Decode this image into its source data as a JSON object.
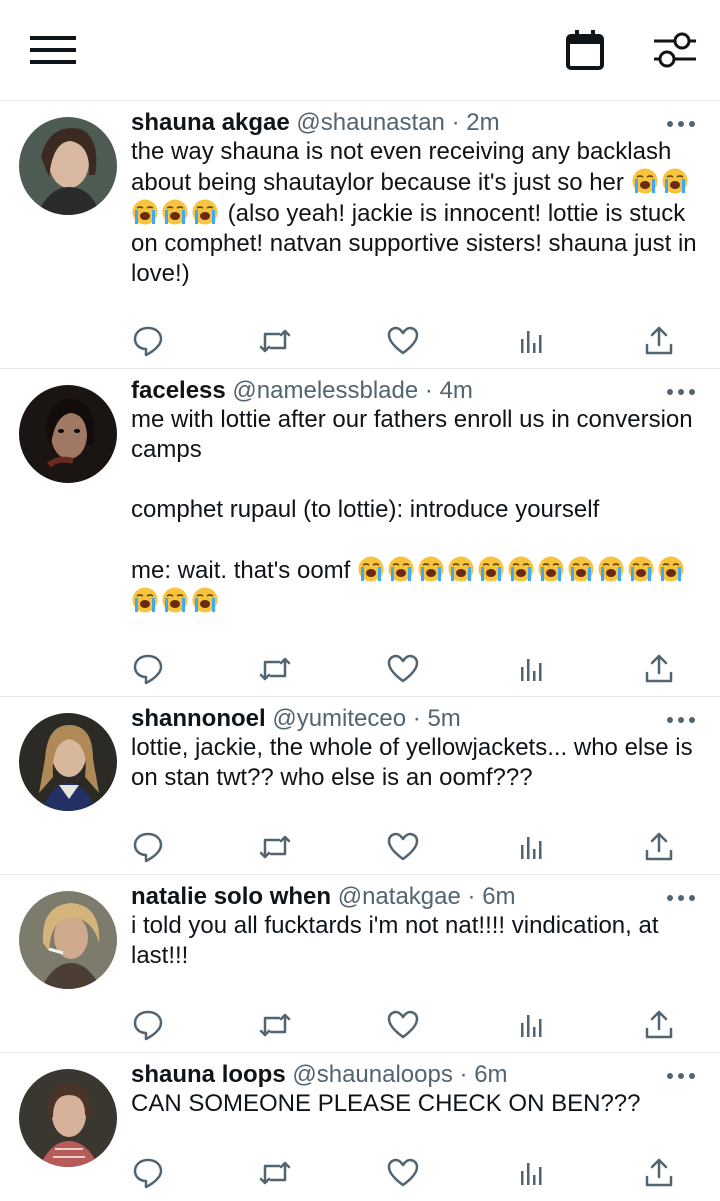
{
  "topbar": {
    "menu_icon": "hamburger-menu-icon",
    "calendar_icon": "calendar-icon",
    "filter_icon": "sliders-filter-icon"
  },
  "tweets": [
    {
      "name": "shauna akgae",
      "handle": "@shaunastan",
      "time": "2m",
      "text_before": "the way shauna is not even receiving any backlash about being shautaylor because it's just so her ",
      "emoji_count": 5,
      "text_after": " (also yeah! jackie is innocent! lottie is stuck on comphet! natvan supportive sisters! shauna just in love!)"
    },
    {
      "name": "faceless",
      "handle": "@namelessblade",
      "time": "4m",
      "text_before": "me with lottie after our fathers enroll us in conversion camps\n\ncomphet rupaul (to lottie): introduce yourself\n\nme: wait. that's oomf ",
      "emoji_count": 14,
      "text_after": ""
    },
    {
      "name": "shannonoel",
      "handle": "@yumiteceo",
      "time": "5m",
      "text_before": "lottie, jackie, the whole of yellowjackets... who else is on stan twt?? who else is an oomf???",
      "emoji_count": 0,
      "text_after": ""
    },
    {
      "name": "natalie solo when",
      "handle": "@natakgae",
      "time": "6m",
      "text_before": "i told you all fucktards i'm not nat!!!! vindication, at last!!!",
      "emoji_count": 0,
      "text_after": ""
    },
    {
      "name": "shauna loops",
      "handle": "@shaunaloops",
      "time": "6m",
      "text_before": "CAN SOMEONE PLEASE CHECK ON BEN???",
      "emoji_count": 0,
      "text_after": ""
    }
  ],
  "separator": "·",
  "emoji_name": "loudly-crying-face",
  "colors": {
    "text": "#0f1419",
    "secondary": "#536471",
    "divider": "#e6e9ec",
    "icon": "#536471",
    "emoji_yellow": "#f7c43d",
    "emoji_tear": "#3fa9f5"
  }
}
